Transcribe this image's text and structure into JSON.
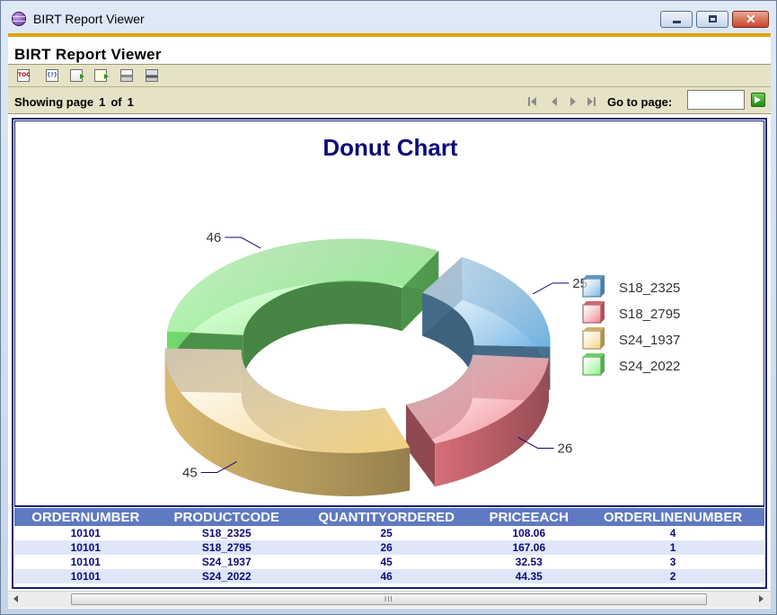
{
  "window": {
    "title": "BIRT Report Viewer"
  },
  "viewer": {
    "title": "BIRT Report Viewer"
  },
  "toolbar": {
    "icons": [
      "toc-icon",
      "parameters-icon",
      "export-report-icon",
      "export-data-icon",
      "print-icon",
      "print-server-icon"
    ],
    "toc_label": "TOC",
    "params_label": "{?}"
  },
  "navigation": {
    "showing": "Showing page",
    "current_page": "1",
    "of": "of",
    "total_pages": "1",
    "goto_label": "Go to page:",
    "goto_value": ""
  },
  "chart_data": {
    "type": "donut",
    "title": "Donut Chart",
    "categories": [
      "S18_2325",
      "S18_2795",
      "S24_1937",
      "S24_2022"
    ],
    "values": [
      25,
      26,
      45,
      46
    ],
    "colors": [
      "#6fb3e3",
      "#f07a86",
      "#f2cf7c",
      "#7ff27a"
    ],
    "legend_position": "right",
    "data_labels": true
  },
  "table": {
    "columns": [
      "ORDERNUMBER",
      "PRODUCTCODE",
      "QUANTITYORDERED",
      "PRICEEACH",
      "ORDERLINENUMBER"
    ],
    "rows": [
      [
        "10101",
        "S18_2325",
        "25",
        "108.06",
        "4"
      ],
      [
        "10101",
        "S18_2795",
        "26",
        "167.06",
        "1"
      ],
      [
        "10101",
        "S24_1937",
        "45",
        "32.53",
        "3"
      ],
      [
        "10101",
        "S24_2022",
        "46",
        "44.35",
        "2"
      ]
    ]
  },
  "scrollbar": {
    "grip": "III"
  },
  "window_buttons": {
    "close": "✕"
  }
}
